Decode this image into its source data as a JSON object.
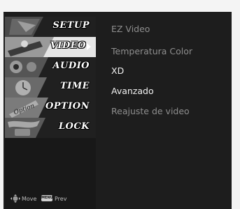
{
  "sidebar": {
    "tabs": [
      {
        "label": "SETUP",
        "active": false
      },
      {
        "label": "VIDEO",
        "active": true
      },
      {
        "label": "AUDIO",
        "active": false
      },
      {
        "label": "TIME",
        "active": false
      },
      {
        "label": "OPTION",
        "active": false
      },
      {
        "label": "LOCK",
        "active": false
      }
    ],
    "active_arrow_icon": "triangle-right-icon",
    "option_art_text": "Option"
  },
  "footer": {
    "move_icon": "four-way-arrow-icon",
    "move_label": "Move",
    "menu_key_label": "MENU",
    "prev_label": "Prev"
  },
  "menu": {
    "items": [
      {
        "label": "EZ Video",
        "enabled": false
      },
      {
        "label": "Temperatura Color",
        "enabled": false
      },
      {
        "label": "XD",
        "enabled": true
      },
      {
        "label": "Avanzado",
        "enabled": true
      },
      {
        "label": "Reajuste de video",
        "enabled": false
      }
    ]
  },
  "colors": {
    "panel_bg": "#1d1d1d",
    "active_tab_bg": "#e6e6e6",
    "enabled_text": "#f2f2f2",
    "disabled_text": "#8e8e8e"
  }
}
